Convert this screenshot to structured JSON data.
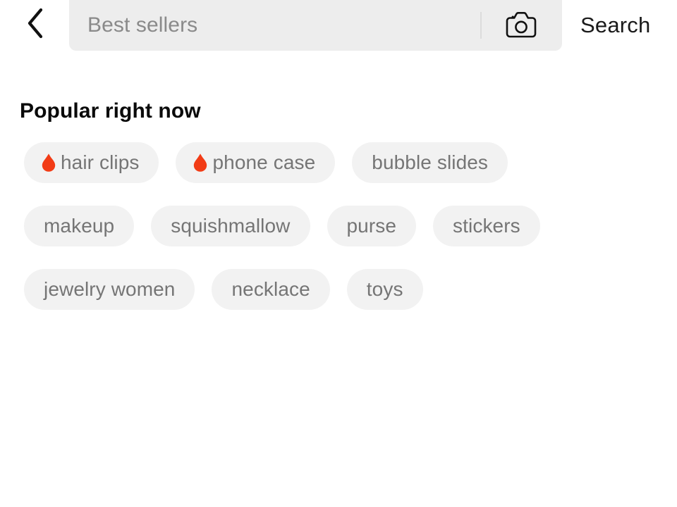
{
  "header": {
    "back_icon": "chevron-left-icon",
    "search": {
      "placeholder": "Best sellers",
      "value": "",
      "camera_icon": "camera-icon"
    },
    "search_action_label": "Search"
  },
  "main": {
    "section_title": "Popular right now",
    "chips": [
      {
        "label": "hair clips",
        "trending": true,
        "icon": "flame-icon"
      },
      {
        "label": "phone case",
        "trending": true,
        "icon": "flame-icon"
      },
      {
        "label": "bubble slides",
        "trending": false,
        "icon": ""
      },
      {
        "label": "makeup",
        "trending": false,
        "icon": ""
      },
      {
        "label": "squishmallow",
        "trending": false,
        "icon": ""
      },
      {
        "label": "purse",
        "trending": false,
        "icon": ""
      },
      {
        "label": "stickers",
        "trending": false,
        "icon": ""
      },
      {
        "label": "jewelry women",
        "trending": false,
        "icon": ""
      },
      {
        "label": "necklace",
        "trending": false,
        "icon": ""
      },
      {
        "label": "toys",
        "trending": false,
        "icon": ""
      }
    ]
  },
  "colors": {
    "page_background": "#ffffff",
    "search_bar_background": "#ededed",
    "chip_background": "#f2f2f2",
    "chip_text": "#757575",
    "placeholder_text": "#8a8a8a",
    "title_text": "#0a0a0a",
    "flame_accent": "#f23c16"
  }
}
